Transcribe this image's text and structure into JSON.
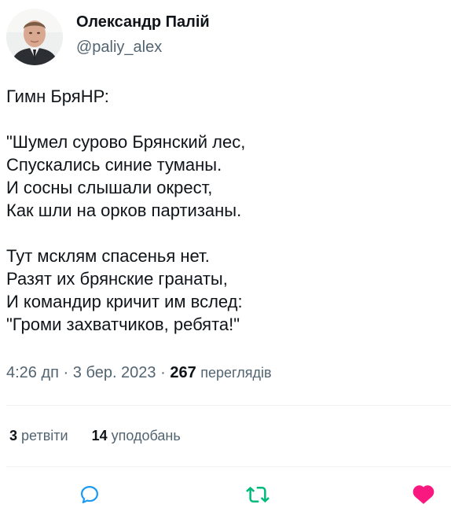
{
  "author": {
    "name": "Олександр Палій",
    "handle": "@paliy_alex"
  },
  "tweet": {
    "lines": [
      "Гимн БряНР:",
      "",
      "\"Шумел сурово Брянский лес,",
      "Спускались синие туманы.",
      "И сосны слышали окрест,",
      "Как шли на орков партизаны.",
      "",
      "Тут мсклям спасенья нет.",
      "Разят их брянские гранаты,",
      "И командир кричит им вслед:",
      "\"Громи захватчиков, ребята!\""
    ]
  },
  "meta": {
    "time": "4:26 дп",
    "separator": "·",
    "date": "3 бер. 2023",
    "views_count": "267",
    "views_label": "переглядів"
  },
  "stats": {
    "retweets_count": "3",
    "retweets_label": "ретвіти",
    "likes_count": "14",
    "likes_label": "уподобань"
  },
  "actions": {
    "reply_icon": "reply-icon",
    "retweet_icon": "retweet-icon",
    "like_icon": "heart-icon"
  },
  "colors": {
    "text_primary": "#0f1419",
    "text_secondary": "#536471",
    "divider": "#eff3f4",
    "reply": "#1d9bf0",
    "retweet": "#00ba7c",
    "like": "#f91880"
  }
}
